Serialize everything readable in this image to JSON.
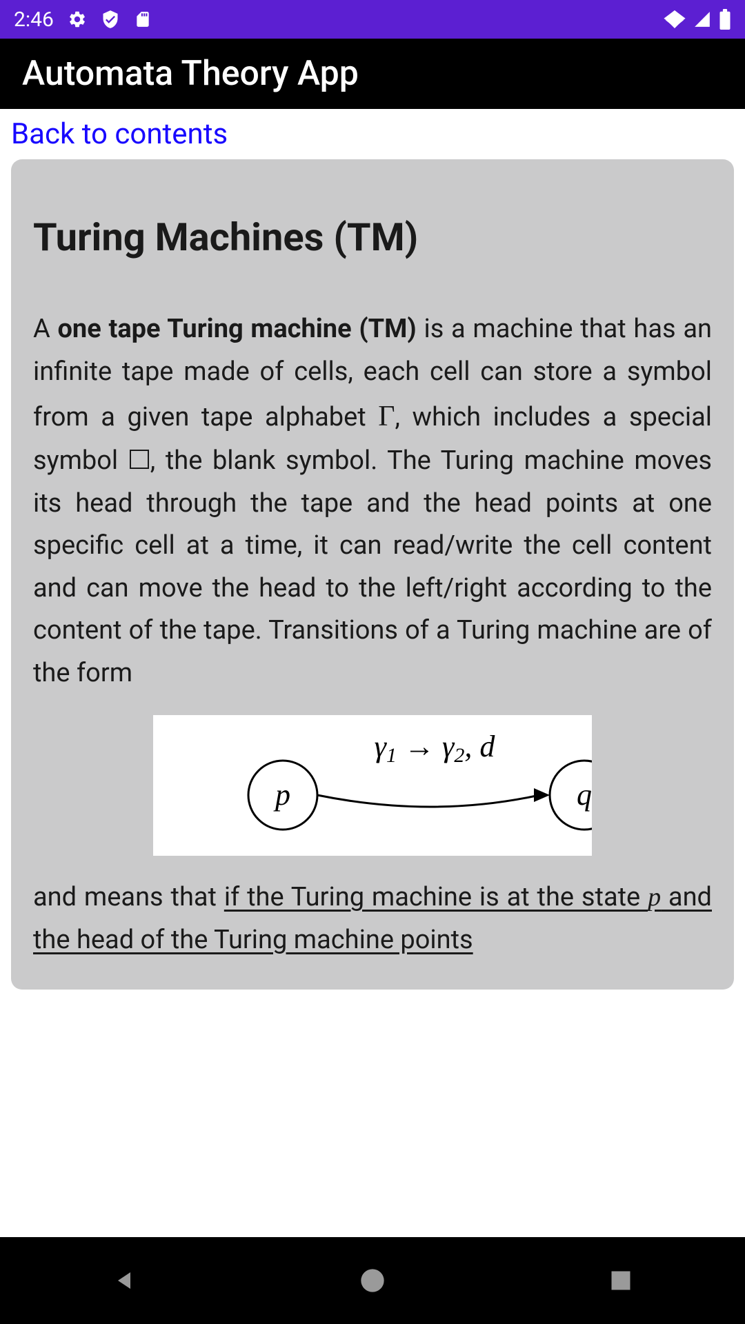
{
  "statusBar": {
    "time": "2:46",
    "icons": {
      "gear": "gear-icon",
      "shield": "shield-icon",
      "sd": "sd-icon",
      "wifi": "wifi-icon",
      "signal": "signal-icon",
      "battery": "battery-icon"
    }
  },
  "header": {
    "title": "Automata Theory App"
  },
  "navigation": {
    "backLink": "Back to contents"
  },
  "article": {
    "title": "Turing Machines (TM)",
    "para1_start": "A ",
    "para1_bold": "one tape Turing machine (TM)",
    "para1_mid1": " is a machine that has an infinite tape made of cells, each cell can store a symbol from a given tape alphabet ",
    "gamma_symbol": "Γ",
    "para1_mid2": ", which includes a special symbol ",
    "para1_mid3": ", the blank symbol. The Turing machine moves its head through the tape and the head points at one specific cell at a time, it can read/write the cell content and can move the head to the left/right according to the content of the tape. Transitions of a Turing machine are of the form",
    "diagram": {
      "state_p": "p",
      "state_q": "q",
      "transition_label": "γ₁ → γ₂, d"
    },
    "para2_start": "and means that ",
    "para2_underline1": "if the Turing machine is at the state ",
    "para2_state": "p",
    "para2_underline2": " and the head of the Turing machine points"
  }
}
